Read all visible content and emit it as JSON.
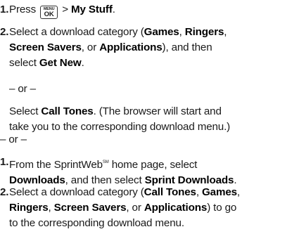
{
  "steps_a": [
    {
      "num": "1.",
      "press": "Press",
      "key_top": "MENU",
      "key_bottom": "OK",
      "gt": ">",
      "target": "My Stuff",
      "period": "."
    },
    {
      "num": "2.",
      "l1_a": "Select a download category (",
      "games": "Games",
      "comma1": ",",
      "ringers": "Ringers",
      "comma2": ",",
      "screen_savers": "Screen Savers",
      "or_word": ", or",
      "applications": "Applications",
      "l2_b": "), and then",
      "l3_a": "select",
      "get_new": "Get New",
      "period": "."
    }
  ],
  "or_1": "– or –",
  "call_tones_block": {
    "select": "Select",
    "call_tones": "Call Tones",
    "rest_l1": ". (The browser will start and",
    "l2": "take you to the corresponding download menu.)"
  },
  "or_2": "– or –",
  "steps_b": [
    {
      "num": "1.",
      "l1_a": "From the SprintWeb",
      "sm": "SM",
      "l1_b": " home page, select",
      "downloads": "Downloads",
      "mid": ", and then select",
      "sprint_downloads": "Sprint Downloads",
      "period": "."
    },
    {
      "num": "2.",
      "l1_a": "Select a download category (",
      "call_tones": "Call Tones",
      "comma1": ",",
      "games": "Games",
      "comma2": ",",
      "ringers": "Ringers",
      "comma3": ",",
      "screen_savers": "Screen Savers",
      "or_word": ", or",
      "applications": "Applications",
      "l2_b": ") to go",
      "l3": "to the corresponding download menu."
    }
  ]
}
